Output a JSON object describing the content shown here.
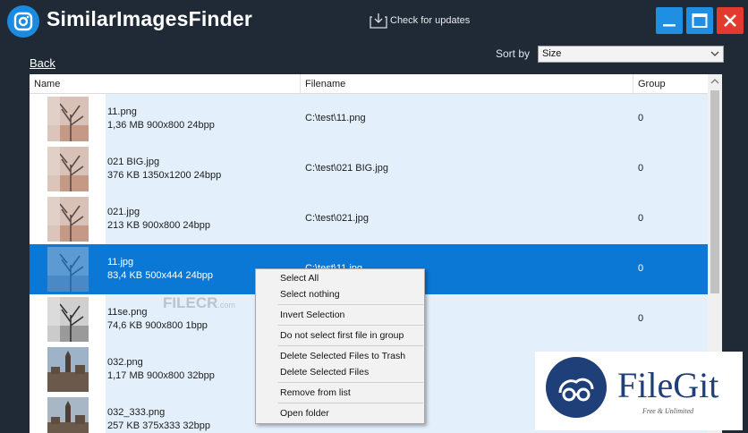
{
  "app": {
    "title": "SimilarImagesFinder",
    "update_label": "Check for updates"
  },
  "nav": {
    "back_label": "Back"
  },
  "sort": {
    "label": "Sort by",
    "value": "Size"
  },
  "table": {
    "headers": {
      "name": "Name",
      "filename": "Filename",
      "group": "Group"
    },
    "rows": [
      {
        "name": "11.png",
        "meta": "1,36 MB  900x800  24bpp",
        "filename": "C:\\test\\11.png",
        "group": "0",
        "selected": false
      },
      {
        "name": "021 BIG.jpg",
        "meta": "376 KB  1350x1200  24bpp",
        "filename": "C:\\test\\021 BIG.jpg",
        "group": "0",
        "selected": false
      },
      {
        "name": "021.jpg",
        "meta": "213 KB  900x800  24bpp",
        "filename": "C:\\test\\021.jpg",
        "group": "0",
        "selected": false
      },
      {
        "name": "11.jpg",
        "meta": "83,4 KB  500x444  24bpp",
        "filename": "C:\\test\\11.jpg",
        "group": "0",
        "selected": true
      },
      {
        "name": "11se.png",
        "meta": "74,6 KB  900x800  1bpp",
        "filename": "",
        "group": "0",
        "selected": false
      },
      {
        "name": "032.png",
        "meta": "1,17 MB  900x800  32bpp",
        "filename": "",
        "group": "",
        "selected": false
      },
      {
        "name": "032_333.png",
        "meta": "257 KB  375x333  32bpp",
        "filename": "",
        "group": "",
        "selected": false
      }
    ]
  },
  "context_menu": {
    "select_all": "Select All",
    "select_nothing": "Select nothing",
    "invert_selection": "Invert Selection",
    "do_not_select_first": "Do not select first file in group",
    "delete_to_trash": "Delete Selected Files to Trash",
    "delete_selected": "Delete Selected Files",
    "remove_from_list": "Remove from list",
    "open_folder": "Open folder"
  },
  "watermarks": {
    "filecr": "FILECR",
    "filecr_com": ".com",
    "filegit": "FileGit",
    "filegit_sub": "Free & Unlimited"
  },
  "colors": {
    "background": "#1f2a36",
    "accent": "#0b78d6",
    "row_tint": "#e3f0fb",
    "close": "#e23a2e"
  }
}
